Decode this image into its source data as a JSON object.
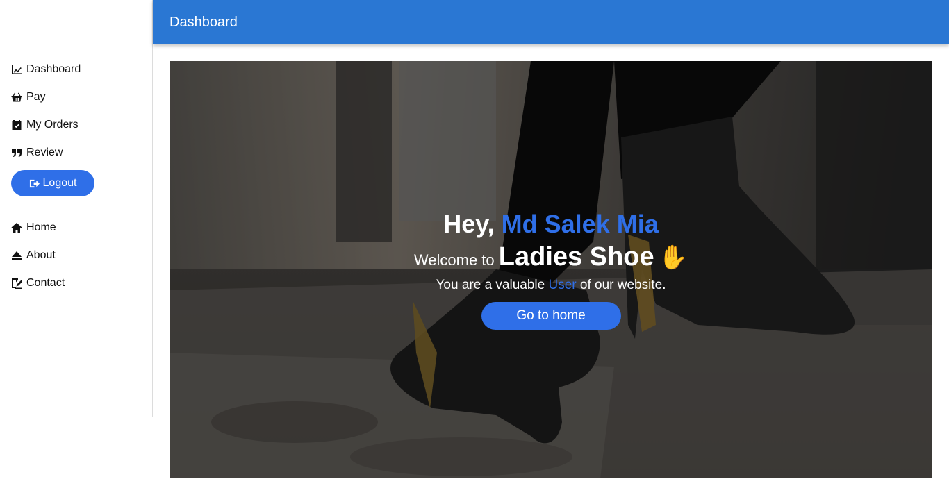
{
  "topbar": {
    "title": "Dashboard"
  },
  "sidebar": {
    "items": [
      {
        "label": "Dashboard",
        "icon": "chart-line-icon"
      },
      {
        "label": "Pay",
        "icon": "basket-icon"
      },
      {
        "label": "My Orders",
        "icon": "calendar-check-icon"
      },
      {
        "label": "Review",
        "icon": "quote-icon"
      }
    ],
    "logout_label": "Logout",
    "lower_items": [
      {
        "label": "Home",
        "icon": "home-icon"
      },
      {
        "label": "About",
        "icon": "eject-icon"
      },
      {
        "label": "Contact",
        "icon": "signature-icon"
      }
    ]
  },
  "hero": {
    "hey_prefix": "Hey,",
    "user_name": "Md Salek Mia",
    "welcome_prefix": "Welcome to",
    "brand": "Ladies Shoe",
    "wave_emoji": "✋",
    "valuable_prefix": "You are a valuable",
    "valuable_role": "User",
    "valuable_suffix": "of our website.",
    "button_label": "Go to home"
  },
  "colors": {
    "primary": "#2a77d3",
    "accent": "#2f6fe8"
  }
}
